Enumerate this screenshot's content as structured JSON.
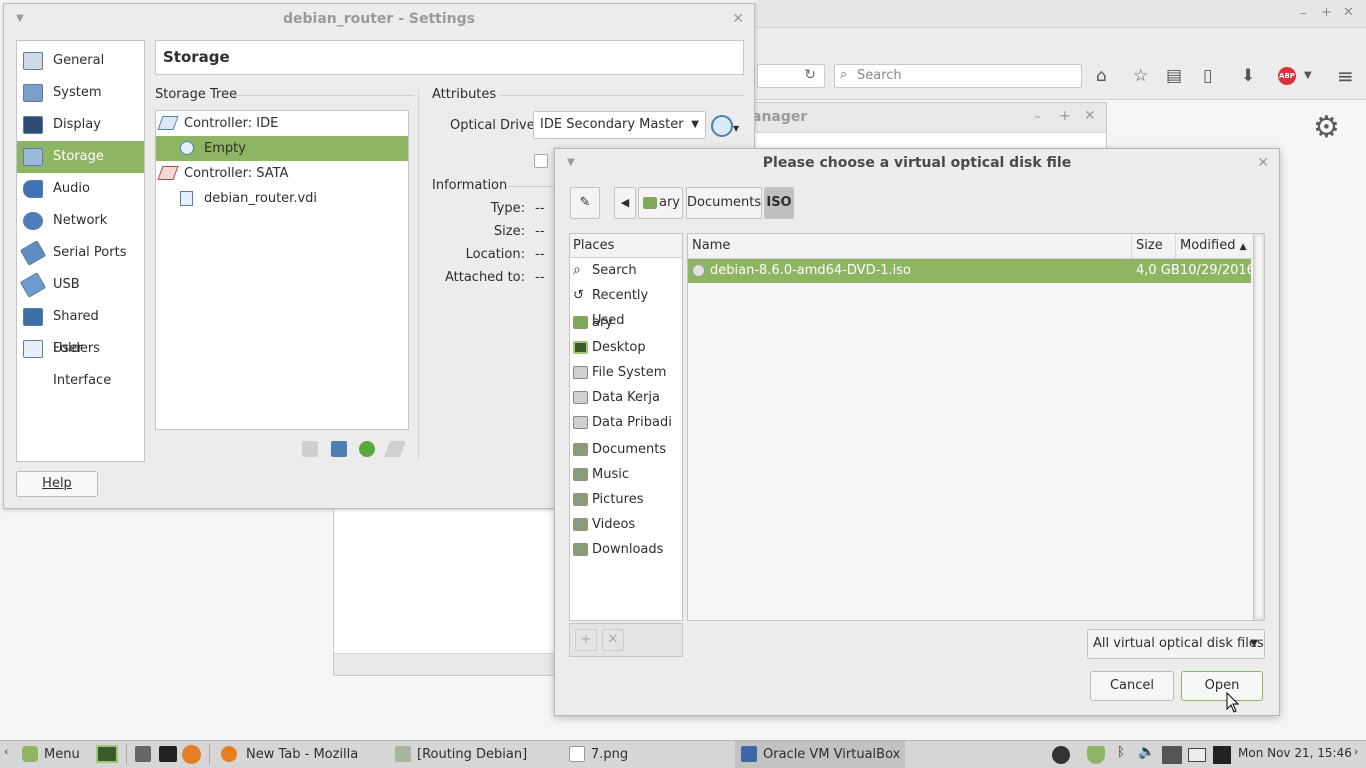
{
  "firefox": {
    "search_placeholder": "Search",
    "abp_badge": "ABP"
  },
  "manager": {
    "title_fragment": "anager"
  },
  "settings": {
    "title": "debian_router - Settings",
    "categories": [
      {
        "label": "General"
      },
      {
        "label": "System"
      },
      {
        "label": "Display"
      },
      {
        "label": "Storage"
      },
      {
        "label": "Audio"
      },
      {
        "label": "Network"
      },
      {
        "label": "Serial Ports"
      },
      {
        "label": "USB"
      },
      {
        "label": "Shared Folders"
      },
      {
        "label": "User Interface"
      }
    ],
    "page_title": "Storage",
    "storage_tree_title": "Storage Tree",
    "tree": [
      {
        "label": "Controller: IDE"
      },
      {
        "label": "Empty"
      },
      {
        "label": "Controller: SATA"
      },
      {
        "label": "debian_router.vdi"
      }
    ],
    "attributes_title": "Attributes",
    "optical_drive_label": "Optical Drive:",
    "optical_drive_value": "IDE Secondary Master",
    "information_title": "Information",
    "info": [
      {
        "label": "Type:",
        "value": "--"
      },
      {
        "label": "Size:",
        "value": "--"
      },
      {
        "label": "Location:",
        "value": "--"
      },
      {
        "label": "Attached to:",
        "value": "--"
      }
    ],
    "help_label": "Help"
  },
  "dialog": {
    "title": "Please choose a virtual optical disk file",
    "path": [
      "ary",
      "Documents",
      "ISO"
    ],
    "places_header": "Places",
    "places": [
      {
        "label": "Search"
      },
      {
        "label": "Recently Used"
      },
      {
        "label": "ary"
      },
      {
        "label": "Desktop"
      },
      {
        "label": "File System"
      },
      {
        "label": "Data Kerja"
      },
      {
        "label": "Data Pribadi"
      },
      {
        "label": "Documents"
      },
      {
        "label": "Music"
      },
      {
        "label": "Pictures"
      },
      {
        "label": "Videos"
      },
      {
        "label": "Downloads"
      }
    ],
    "columns": {
      "name": "Name",
      "size": "Size",
      "modified": "Modified"
    },
    "files": [
      {
        "name": "debian-8.6.0-amd64-DVD-1.iso",
        "size": "4,0 GB",
        "modified": "10/29/2016"
      }
    ],
    "filter": "All virtual optical disk files",
    "cancel_label": "Cancel",
    "open_label": "Open"
  },
  "taskbar": {
    "menu_label": "Menu",
    "tasks": [
      {
        "label": "New Tab - Mozilla Fire..."
      },
      {
        "label": "[Routing Debian]"
      },
      {
        "label": "7.png"
      },
      {
        "label": "Oracle VM VirtualBox ..."
      }
    ],
    "clock": "Mon Nov 21, 15:46"
  },
  "colors": {
    "selection": "#8eb563",
    "panel": "#ececec"
  }
}
